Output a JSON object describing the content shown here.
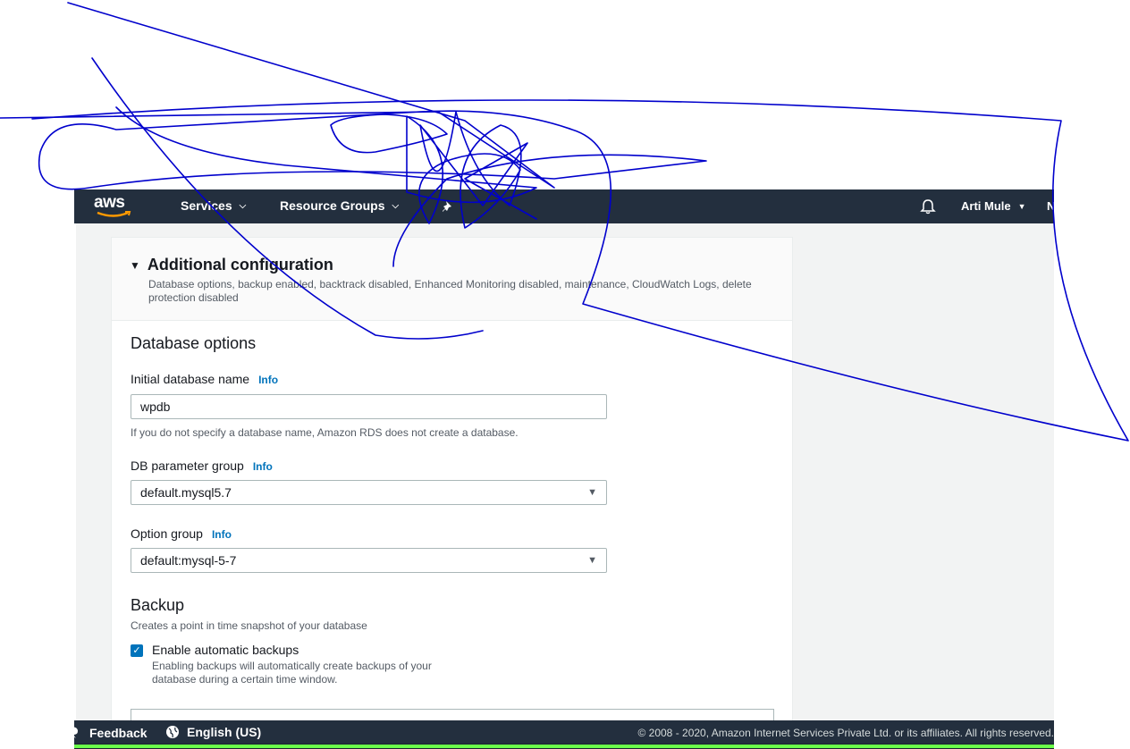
{
  "nav": {
    "logo_text": "aws",
    "services_label": "Services",
    "resource_groups_label": "Resource Groups",
    "user_label": "Arti Mule",
    "region_label": "N"
  },
  "panel": {
    "expand_title": "Additional configuration",
    "summary": "Database options, backup enabled, backtrack disabled, Enhanced Monitoring disabled, maintenance, CloudWatch Logs, delete protection disabled",
    "database_options_title": "Database options",
    "initial_db_label": "Initial database name",
    "initial_db_value": "wpdb",
    "initial_db_hint": "If you do not specify a database name, Amazon RDS does not create a database.",
    "param_group_label": "DB parameter group",
    "param_group_value": "default.mysql5.7",
    "option_group_label": "Option group",
    "option_group_value": "default:mysql-5-7",
    "info_label": "Info",
    "backup_title": "Backup",
    "backup_desc": "Creates a point in time snapshot of your database",
    "enable_backups_label": "Enable automatic backups",
    "enable_backups_checked": true,
    "enable_backups_desc": "Enabling backups will automatically create backups of your database during a certain time window."
  },
  "footer": {
    "feedback_label": "Feedback",
    "language_label": "English (US)",
    "copyright": "© 2008 - 2020, Amazon Internet Services Private Ltd. or its affiliates. All rights reserved."
  },
  "colors": {
    "nav_bg": "#232f3e",
    "link": "#0073bb",
    "scribble": "#0000cc",
    "progress": "#6aff4a"
  }
}
